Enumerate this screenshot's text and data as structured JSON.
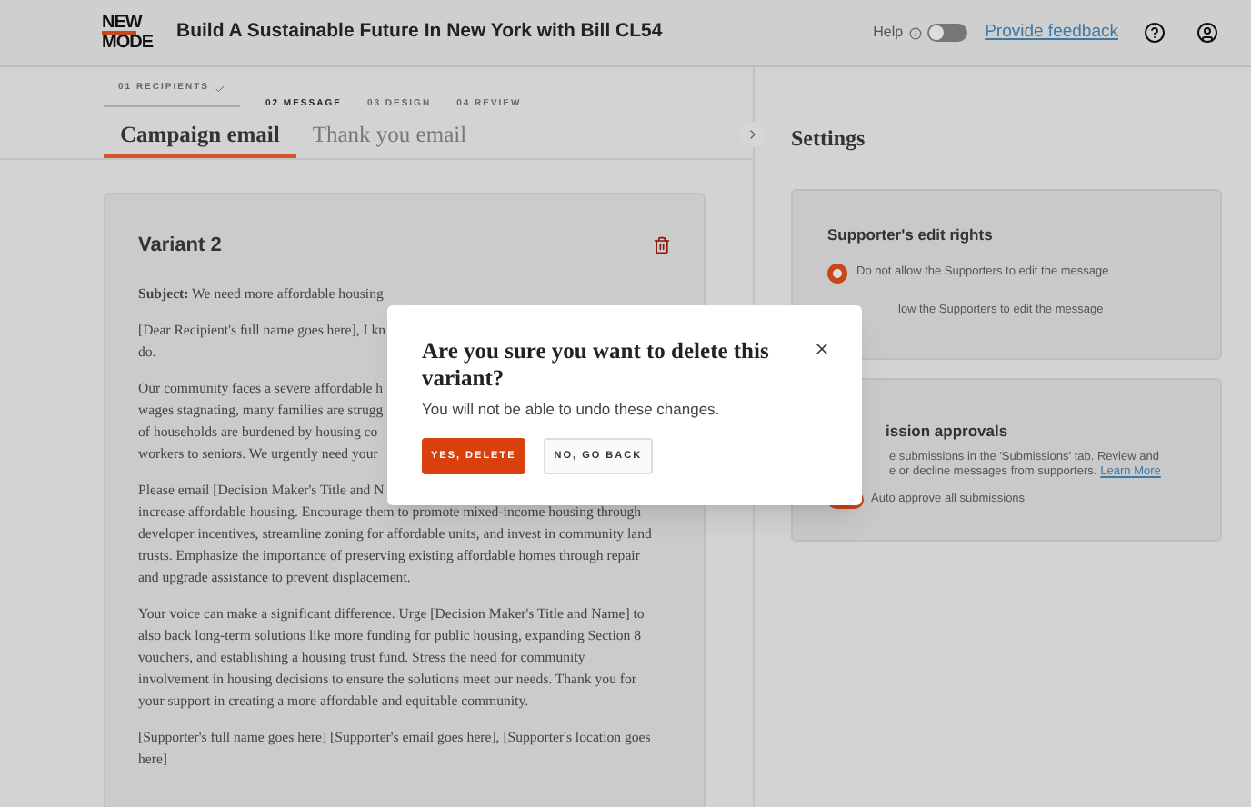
{
  "header": {
    "logo_lines": [
      "NEW",
      "MODE"
    ],
    "title": "Build A Sustainable Future In New York with Bill CL54",
    "help_label": "Help",
    "help_toggle_on": false,
    "feedback_link": "Provide feedback"
  },
  "steps": [
    {
      "label": "01 RECIPIENTS",
      "done": true,
      "selected": false
    },
    {
      "label": "02 MESSAGE",
      "done": false,
      "selected": true
    },
    {
      "label": "03 DESIGN",
      "done": false,
      "selected": false
    },
    {
      "label": "04 REVIEW",
      "done": false,
      "selected": false
    }
  ],
  "tabs": [
    {
      "label": "Campaign email",
      "selected": true
    },
    {
      "label": "Thank you email",
      "selected": false
    }
  ],
  "variant": {
    "title": "Variant 2",
    "subject_label": "Subject:",
    "subject": "We need more affordable housing",
    "paragraphs": [
      {
        "lines": [
          "[Dear Recipient's full name goes here], I kn",
          "do."
        ]
      },
      {
        "lines": [
          "Our community faces a severe affordable h",
          "wages stagnating, many families are strugg",
          "of households are burdened by housing co",
          "workers to seniors. We urgently need your"
        ]
      },
      {
        "lines": [
          "Please email [Decision Maker's Title and N",
          "increase affordable housing. Encourage them to promote mixed-income housing through",
          "developer incentives, streamline zoning for affordable units, and invest in community land",
          "trusts. Emphasize the importance of preserving existing affordable homes through repair",
          "and upgrade assistance to prevent displacement."
        ]
      },
      {
        "lines": [
          "Your voice can make a significant difference. Urge [Decision Maker's Title and Name] to",
          "also back long-term solutions like more funding for public housing, expanding Section 8",
          "vouchers, and establishing a housing trust fund. Stress the need for community",
          "involvement in housing decisions to ensure the solutions meet our needs. Thank you for",
          "your support in creating a more affordable and equitable community."
        ]
      },
      {
        "lines": [
          "[Supporter's full name goes here] [Supporter's email goes here], [Supporter's location goes",
          "here]"
        ]
      }
    ]
  },
  "settings": {
    "title": "Settings",
    "edit_rights": {
      "title": "Supporter's edit rights",
      "option_1": {
        "label": "Do not allow the Supporters to edit the message",
        "selected": true
      },
      "option_2_fragment": "low the Supporters to edit the message"
    },
    "approvals": {
      "title_fragment": "ission approvals",
      "desc_lines": [
        "e submissions in the 'Submissions' tab. Review and",
        "e or decline messages from supporters."
      ],
      "learn_more": "Learn More",
      "auto_approve": {
        "label": "Auto approve all submissions",
        "on": true
      }
    }
  },
  "dialog": {
    "title": "Are you sure you want to delete this variant?",
    "message": "You will not be able to undo these changes.",
    "confirm": "YES, DELETE",
    "cancel": "NO, GO BACK"
  }
}
